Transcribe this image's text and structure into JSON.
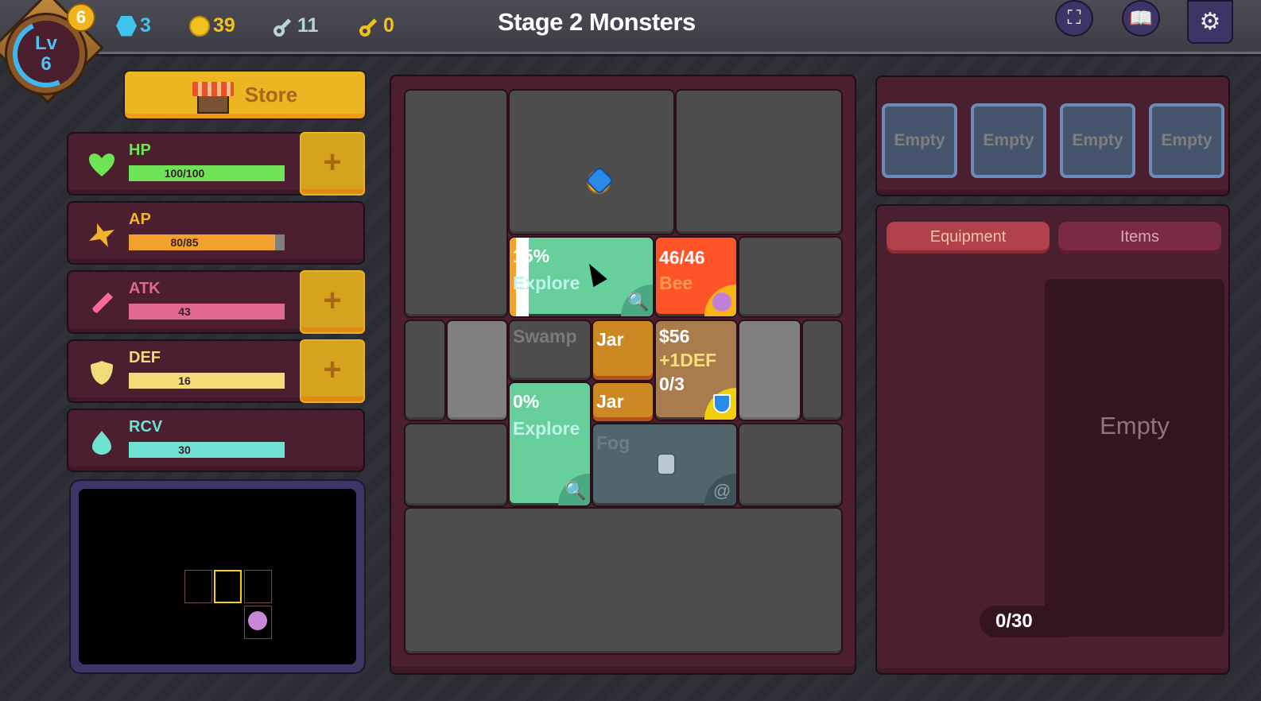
{
  "header": {
    "level_label": "Lv",
    "level_value": "6",
    "level_badge_count": "6",
    "resources": [
      {
        "name": "gem",
        "value": "3",
        "color": "#3fc4ee"
      },
      {
        "name": "coin",
        "value": "39",
        "color": "#f2c21c"
      },
      {
        "name": "silver-key",
        "value": "11",
        "color": "#b8d4d8"
      },
      {
        "name": "gold-key",
        "value": "0",
        "color": "#f2c21c"
      }
    ],
    "stage_title": "Stage 2  Monsters",
    "buttons": {
      "fullscreen": "fullscreen",
      "book": "book",
      "settings": "settings"
    }
  },
  "store": {
    "label": "Store"
  },
  "stats": [
    {
      "label": "HP",
      "value": "100/100",
      "fraction": 1.0,
      "color": "#6fe356",
      "upgradable": true,
      "icon": "heart"
    },
    {
      "label": "AP",
      "value": "80/85",
      "fraction": 0.941,
      "color": "#f2a22c",
      "upgradable": false,
      "icon": "star"
    },
    {
      "label": "ATK",
      "value": "43",
      "fraction": 1.0,
      "color": "#e06892",
      "upgradable": true,
      "icon": "sword"
    },
    {
      "label": "DEF",
      "value": "16",
      "fraction": 1.0,
      "color": "#f2dc78",
      "upgradable": true,
      "icon": "shield"
    },
    {
      "label": "RCV",
      "value": "30",
      "fraction": 1.0,
      "color": "#6fe2d4",
      "upgradable": false,
      "icon": "drop"
    }
  ],
  "stat_plus_label": "+",
  "board": {
    "tiles": {
      "explore_top": {
        "line1": "15%",
        "line2": "Explore",
        "progress": 0.15
      },
      "monster": {
        "line1": "46/46",
        "line2": "Bee"
      },
      "swamp": {
        "line1": "Swamp"
      },
      "jar1": {
        "line1": "Jar"
      },
      "jar2": {
        "line1": "Jar"
      },
      "shop": {
        "line1": "$56",
        "line2": "+1DEF",
        "line3": "0/3"
      },
      "explore_bottom": {
        "line1": "0%",
        "line2": "Explore"
      },
      "fog": {
        "line1": "Fog"
      }
    }
  },
  "equipment_slots": [
    "Empty",
    "Empty",
    "Empty",
    "Empty"
  ],
  "inventory": {
    "tabs": [
      {
        "label": "Equipment",
        "active": true
      },
      {
        "label": "Items",
        "active": false
      }
    ],
    "detail_label": "Empty",
    "count": "0/30"
  }
}
